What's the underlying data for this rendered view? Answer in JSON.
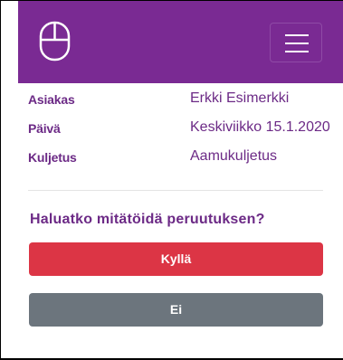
{
  "header": {
    "logo_icon": "mouse-icon",
    "menu_icon": "hamburger-menu-icon",
    "background_color": "#7a2a93"
  },
  "details": [
    {
      "label": "Asiakas",
      "value": "Erkki Esimerkki"
    },
    {
      "label": "Päivä",
      "value": "Keskiviikko 15.1.2020"
    },
    {
      "label": "Kuljetus",
      "value": "Aamukuljetus"
    }
  ],
  "confirm": {
    "question": "Haluatko mitätöidä peruutuksen?",
    "yes_label": "Kyllä",
    "no_label": "Ei",
    "yes_color": "#dc3545",
    "no_color": "#6c757d"
  }
}
